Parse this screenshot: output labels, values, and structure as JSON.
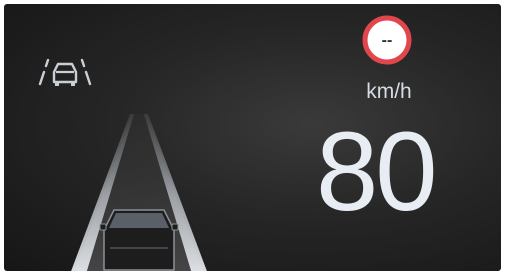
{
  "cluster": {
    "speed_unit": "km/h",
    "speed_value": "80",
    "speed_limit_sign": "--",
    "icons": {
      "assist": "lane-following-assist-icon",
      "scene": "road-lane-vehicle-icon",
      "sign": "speed-limit-sign-icon"
    },
    "colors": {
      "background": "#262626",
      "text": "#e8edf3",
      "sign_ring": "#e0464b",
      "sign_fill": "#ffffff"
    }
  }
}
